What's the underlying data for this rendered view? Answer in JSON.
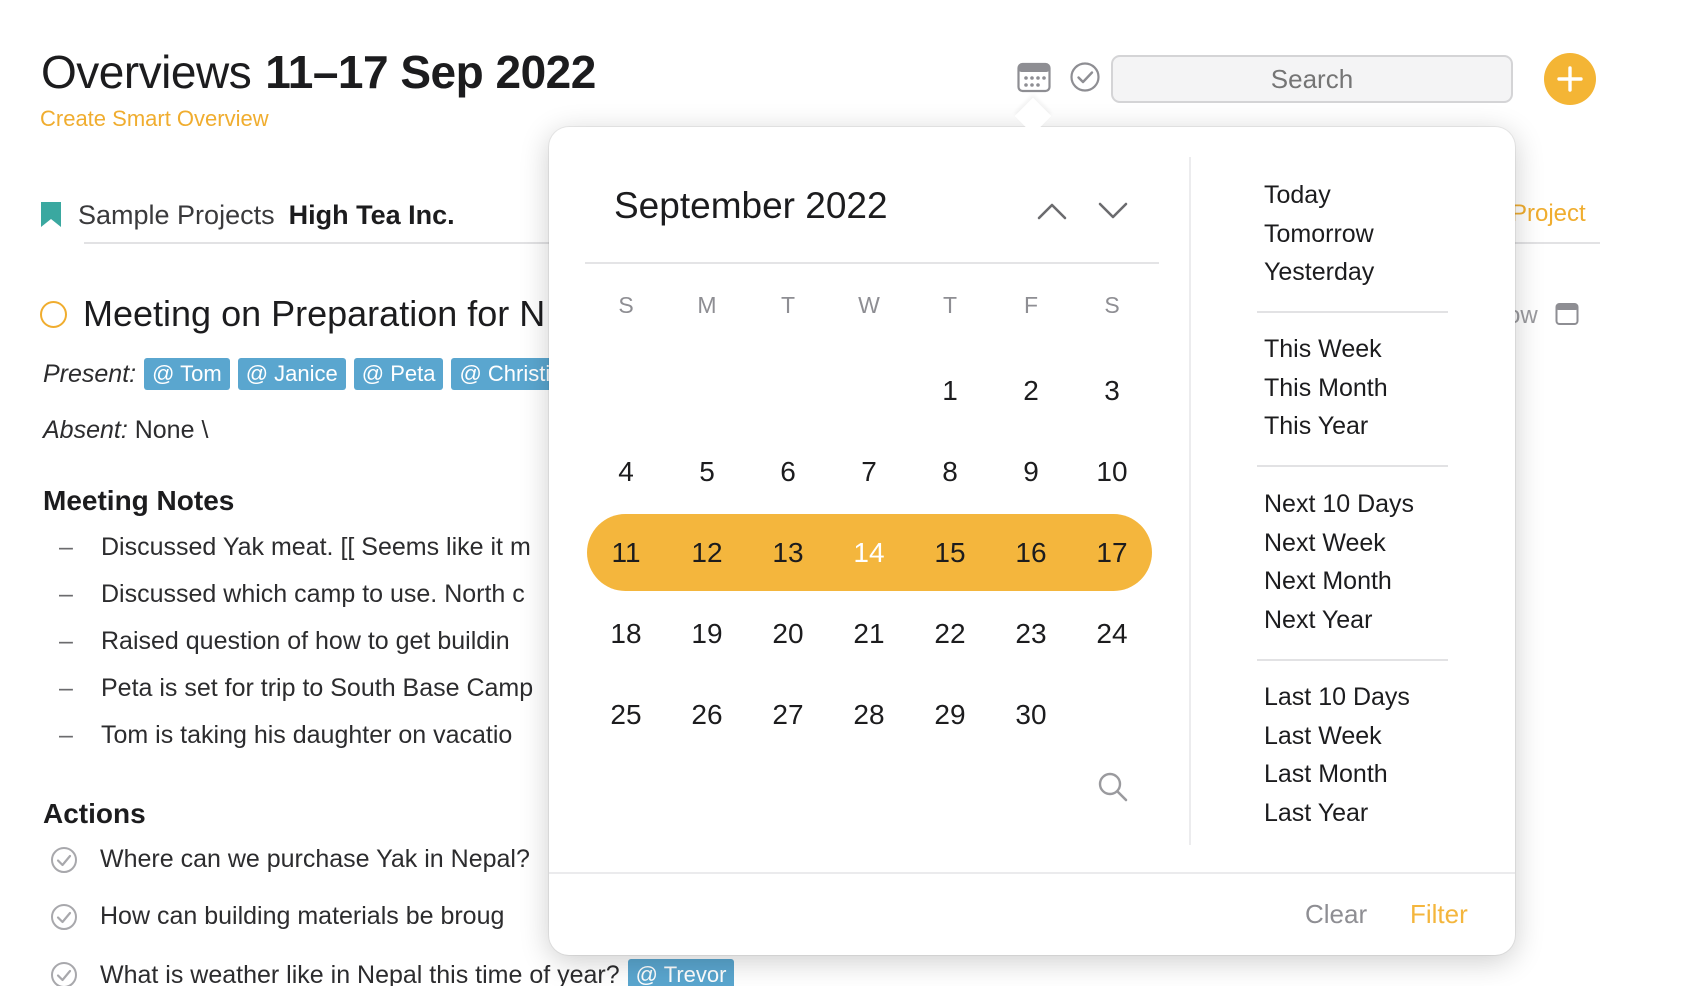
{
  "header": {
    "title_light": "Overviews",
    "title_bold": "11–17 Sep 2022",
    "smart_overview_link": "Create Smart Overview",
    "search_placeholder": "Search",
    "accent_color": "#f4b535"
  },
  "breadcrumb": {
    "folder": "Sample Projects",
    "project": "High Tea Inc.",
    "right_link": "Project"
  },
  "task": {
    "title": "Meeting on Preparation for N",
    "right_partial": "ow"
  },
  "present": {
    "label": "Present:",
    "tags": [
      "@ Tom",
      "@ Janice",
      "@ Peta",
      "@ Christian"
    ]
  },
  "absent": {
    "label": "Absent:",
    "value": " None \\"
  },
  "meeting_notes": {
    "heading": "Meeting Notes",
    "items": [
      "Discussed Yak meat. [[ Seems like it m",
      "Discussed which camp to use. North c",
      "Raised question of how to get buildin",
      "Peta is set for trip to South Base Camp",
      "Tom is taking his daughter on vacatio"
    ]
  },
  "actions": {
    "heading": "Actions",
    "items": [
      {
        "text": "Where can we purchase Yak in Nepal?",
        "tag": ""
      },
      {
        "text": "How can building materials be broug",
        "tag": ""
      },
      {
        "text": "What is weather like in Nepal this time of year?",
        "tag": "@ Trevor"
      }
    ]
  },
  "calendar": {
    "month_label": "September 2022",
    "weekdays": [
      "S",
      "M",
      "T",
      "W",
      "T",
      "F",
      "S"
    ],
    "weeks": [
      [
        "",
        "",
        "",
        "",
        "1",
        "2",
        "3"
      ],
      [
        "4",
        "5",
        "6",
        "7",
        "8",
        "9",
        "10"
      ],
      [
        "11",
        "12",
        "13",
        "14",
        "15",
        "16",
        "17"
      ],
      [
        "18",
        "19",
        "20",
        "21",
        "22",
        "23",
        "24"
      ],
      [
        "25",
        "26",
        "27",
        "28",
        "29",
        "30",
        ""
      ]
    ],
    "selected_week_index": 2,
    "today": "14",
    "highlight_color": "#f4b63d"
  },
  "quick_ranges": {
    "group1": [
      "Today",
      "Tomorrow",
      "Yesterday"
    ],
    "group2": [
      "This Week",
      "This Month",
      "This Year"
    ],
    "group3": [
      "Next 10 Days",
      "Next Week",
      "Next Month",
      "Next Year"
    ],
    "group4": [
      "Last 10 Days",
      "Last Week",
      "Last Month",
      "Last Year"
    ]
  },
  "footer": {
    "clear_label": "Clear",
    "filter_label": "Filter"
  },
  "icons": {
    "calendar_toolbar": "calendar-icon",
    "review": "check-circle-icon",
    "add": "plus-icon",
    "bookmark": "bookmark-icon",
    "search": "search-icon"
  }
}
